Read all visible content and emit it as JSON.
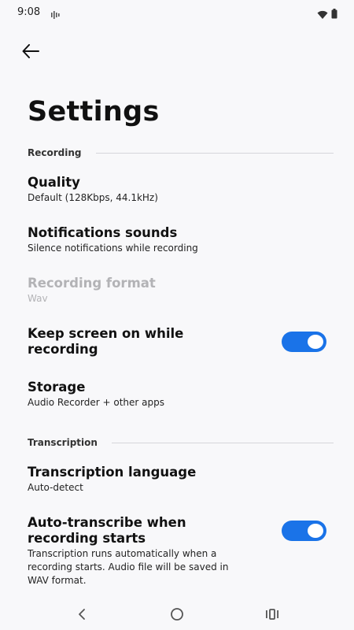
{
  "status_bar": {
    "time": "9:08"
  },
  "header": {
    "back_icon": "arrow-left-icon",
    "title": "Settings"
  },
  "sections": {
    "recording": {
      "label": "Recording",
      "items": [
        {
          "title": "Quality",
          "summary": "Default (128Kbps, 44.1kHz)"
        },
        {
          "title": "Notifications sounds",
          "summary": "Silence notifications while recording"
        },
        {
          "title": "Recording format",
          "summary": "Wav",
          "enabled": false
        },
        {
          "title": "Keep screen on while recording",
          "toggle_on": true
        },
        {
          "title": "Storage",
          "summary": "Audio Recorder + other apps"
        }
      ]
    },
    "transcription": {
      "label": "Transcription",
      "items": [
        {
          "title": "Transcription language",
          "summary": "Auto-detect"
        },
        {
          "title": "Auto-transcribe when recording starts",
          "summary": "Transcription runs automatically when a recording starts. Audio file will be saved in WAV format.",
          "toggle_on": true
        }
      ]
    }
  },
  "colors": {
    "accent": "#1a73e8",
    "background": "#f8f8fa",
    "disabled_text": "#b3b3b6"
  },
  "nav_bar": {
    "icons": [
      "back-chevron-icon",
      "home-circle-icon",
      "recents-icon"
    ]
  }
}
